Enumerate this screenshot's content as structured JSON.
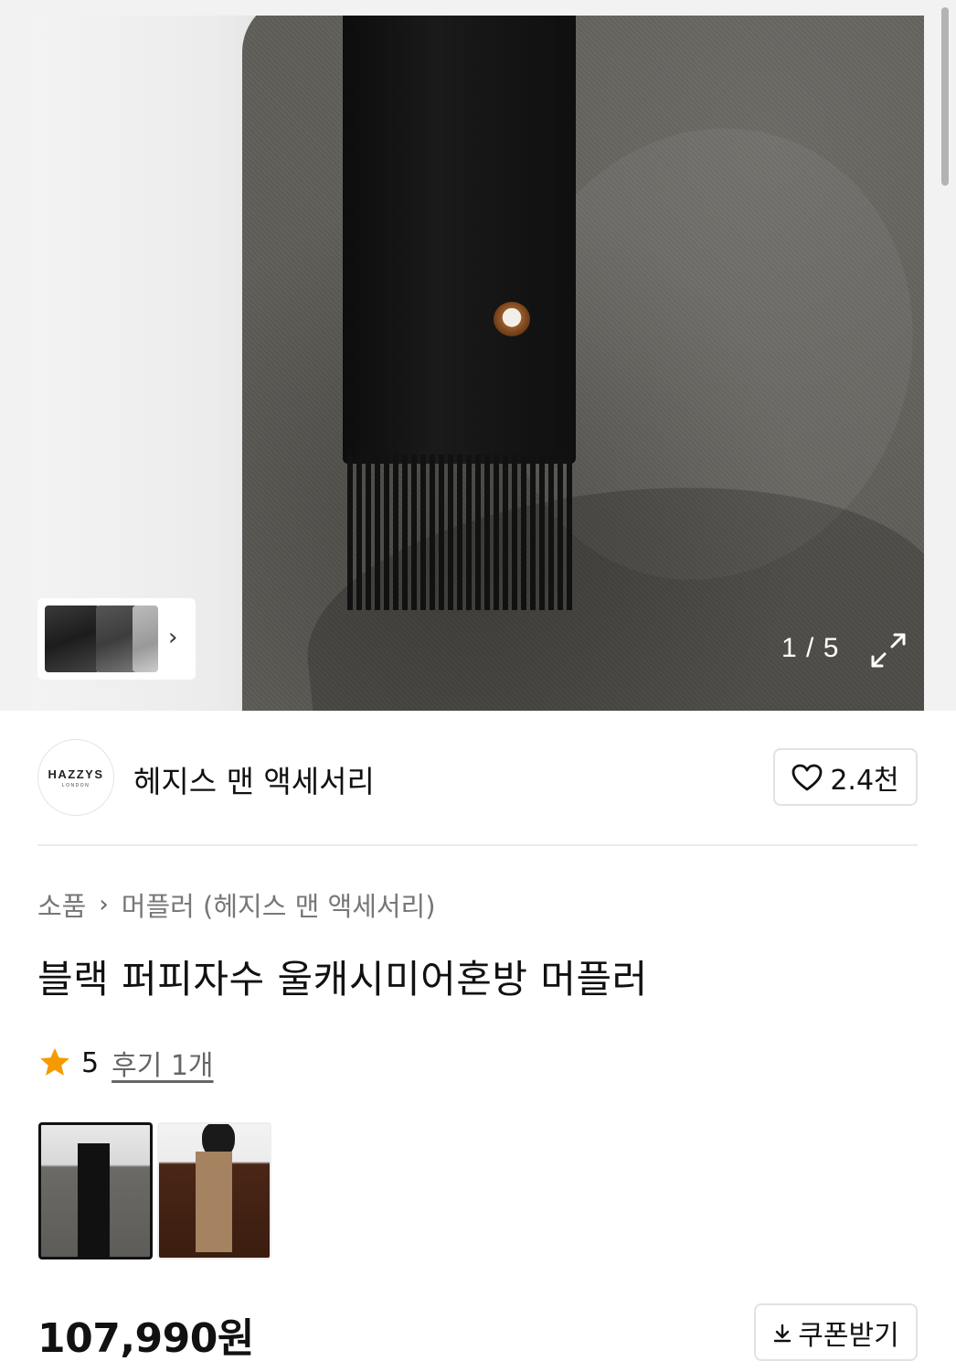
{
  "gallery": {
    "counter": "1 / 5",
    "thumb_more_icon": "chevron-right-icon",
    "expand_icon": "expand-icon"
  },
  "brand": {
    "logo_text": "HAZZYS",
    "logo_subtext": "LONDON",
    "name": "헤지스 맨 액세서리",
    "likes": "2.4천",
    "like_icon": "heart-icon"
  },
  "breadcrumb": {
    "items": [
      "소품",
      "머플러 (헤지스 맨 액세서리)"
    ],
    "separator_icon": "chevron-right-icon"
  },
  "product": {
    "title": "블랙 퍼피자수 울캐시미어혼방 머플러",
    "rating": "5",
    "rating_icon": "star-icon",
    "rating_color": "#f59a00",
    "review_link": "후기 1개",
    "price": "107,990원"
  },
  "coupon": {
    "label": "쿠폰받기",
    "icon": "download-icon"
  }
}
